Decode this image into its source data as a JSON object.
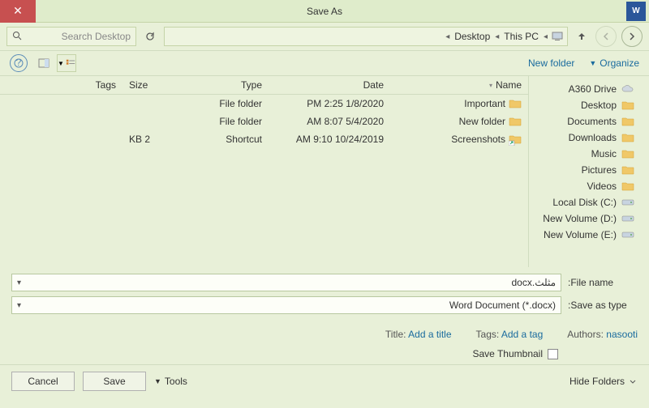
{
  "title": "Save As",
  "breadcrumb": {
    "pc": "This PC",
    "loc": "Desktop"
  },
  "search_placeholder": "Search Desktop",
  "organize": "Organize",
  "newfolder": "New folder",
  "tree": [
    {
      "label": "A360 Drive",
      "kind": "cloud"
    },
    {
      "label": "Desktop",
      "kind": "folder"
    },
    {
      "label": "Documents",
      "kind": "folder"
    },
    {
      "label": "Downloads",
      "kind": "folder"
    },
    {
      "label": "Music",
      "kind": "folder"
    },
    {
      "label": "Pictures",
      "kind": "folder"
    },
    {
      "label": "Videos",
      "kind": "folder"
    },
    {
      "label": "Local Disk (C:)",
      "kind": "drive"
    },
    {
      "label": "New Volume (D:)",
      "kind": "drive"
    },
    {
      "label": "New Volume (E:)",
      "kind": "drive"
    }
  ],
  "cols": {
    "name": "Name",
    "date": "Date",
    "type": "Type",
    "size": "Size",
    "tags": "Tags"
  },
  "files": [
    {
      "name": "Important",
      "date": "1/8/2020 2:25 PM",
      "type": "File folder",
      "size": "",
      "kind": "folder"
    },
    {
      "name": "New folder",
      "date": "5/4/2020 8:07 AM",
      "type": "File folder",
      "size": "",
      "kind": "folder"
    },
    {
      "name": "Screenshots",
      "date": "10/24/2019 9:10 AM",
      "type": "Shortcut",
      "size": "2 KB",
      "kind": "shortcut"
    }
  ],
  "filename_label": "File name:",
  "filename_value": "مثلث.docx",
  "savetype_label": "Save as type:",
  "savetype_value": "Word Document (*.docx)",
  "authors_label": "Authors:",
  "authors_value": "nasooti",
  "tags_label": "Tags:",
  "tags_placeholder": "Add a tag",
  "title_label": "Title:",
  "title_placeholder": "Add a title",
  "save_thumb": "Save Thumbnail",
  "hide_folders": "Hide Folders",
  "tools": "Tools",
  "save": "Save",
  "cancel": "Cancel"
}
